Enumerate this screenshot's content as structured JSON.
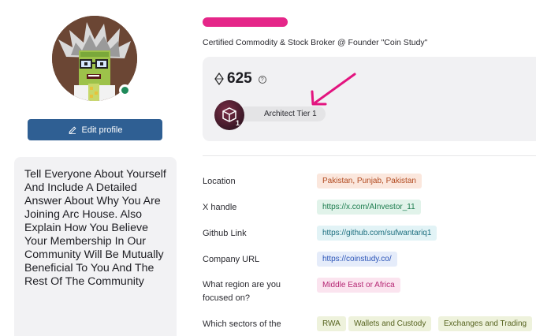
{
  "profile": {
    "avatar_alt": "pixel art avatar",
    "online_status_color": "#1f8a5a",
    "edit_label": "Edit profile",
    "headline": "Certified Commodity & Stock Broker @ Founder \"Coin Study\"",
    "bio": "Tell Everyone About Yourself And Include A Detailed Answer About Why You Are Joining Arc House. Also Explain How You Believe Your Membership In Our Community Will Be Mutually Beneficial To You And The Rest Of The Community"
  },
  "points": {
    "value": "625",
    "help": "?"
  },
  "tier": {
    "label": "Architect Tier 1",
    "number": "1"
  },
  "fields": {
    "location": {
      "label": "Location",
      "value": "Pakistan, Punjab, Pakistan"
    },
    "x_handle": {
      "label": "X handle",
      "value": "https://x.com/AInvestor_11"
    },
    "github": {
      "label": "Github Link",
      "value": "https://github.com/sufwantariq1"
    },
    "company": {
      "label": "Company URL",
      "value": "https://coinstudy.co/"
    },
    "region": {
      "label": "What region are you focused on?",
      "value": "Middle East or Africa"
    },
    "sectors": {
      "label": "Which sectors of the",
      "values": [
        "RWA",
        "Wallets and Custody",
        "Exchanges and Trading"
      ]
    }
  },
  "colors": {
    "accent_button": "#2f5f93",
    "annotation_arrow": "#e3147f",
    "redaction": "#e3147f"
  }
}
